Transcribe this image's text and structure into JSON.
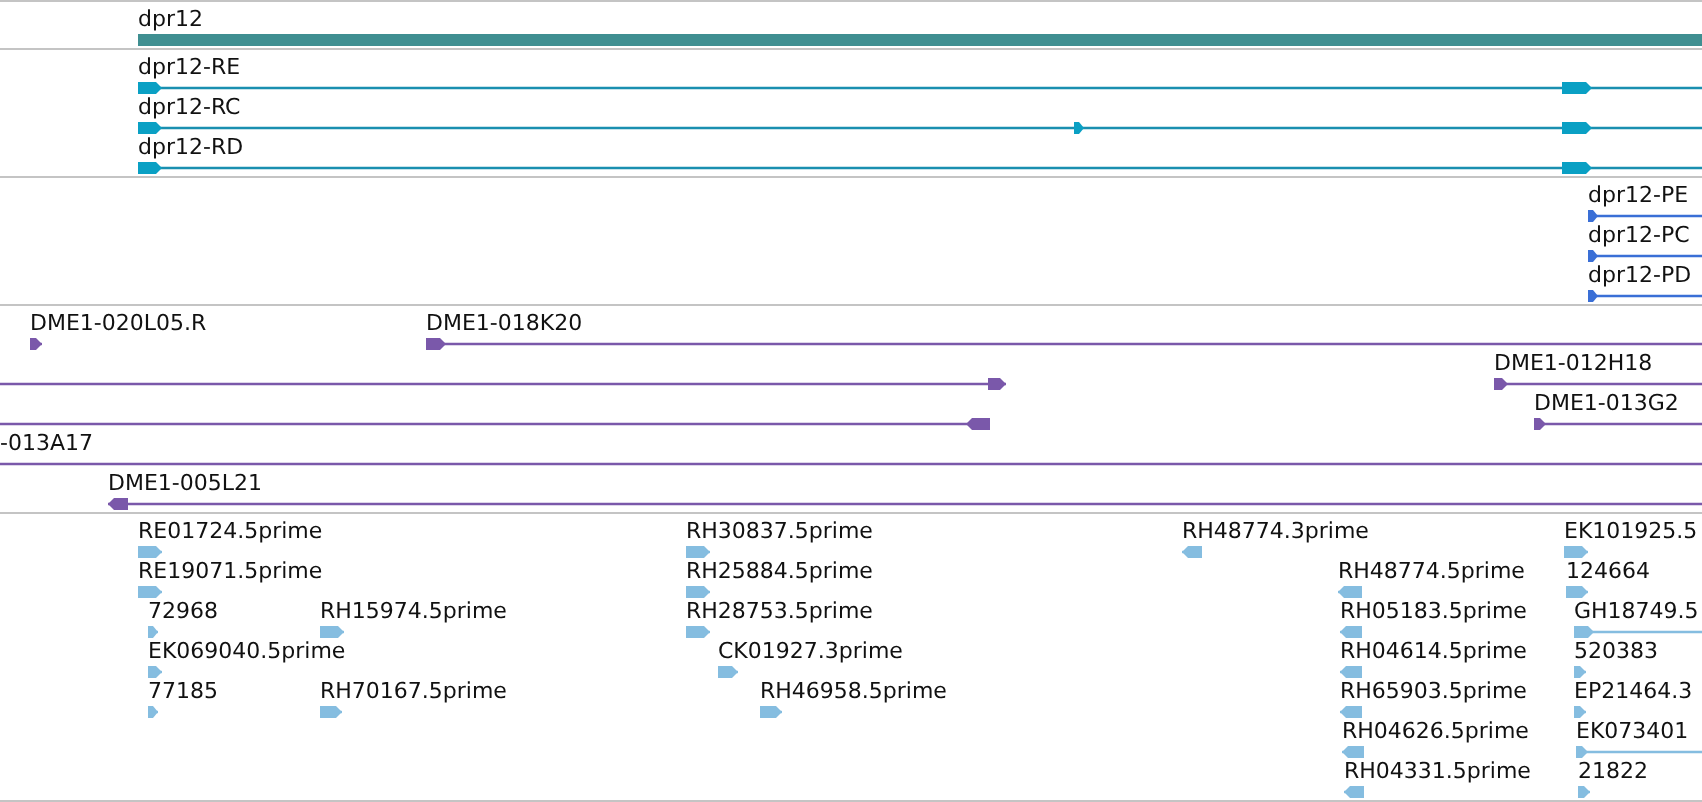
{
  "tracks": [
    {
      "kind": "gene",
      "features": [
        {
          "label": "dpr12"
        }
      ]
    },
    {
      "kind": "transcript",
      "features": [
        {
          "label": "dpr12-RE",
          "reverse": false
        },
        {
          "label": "dpr12-RC",
          "reverse": false
        },
        {
          "label": "dpr12-RD",
          "reverse": false
        }
      ]
    },
    {
      "kind": "protein",
      "features": [
        {
          "label": "dpr12-PE",
          "reverse": false
        },
        {
          "label": "dpr12-PC",
          "reverse": false
        },
        {
          "label": "dpr12-PD",
          "reverse": false
        }
      ]
    },
    {
      "kind": "clone",
      "features": [
        {
          "label": "DME1-020L05.R",
          "reverse": false
        },
        {
          "label": "DME1-018K20",
          "reverse": false
        },
        {
          "reverse": false
        },
        {
          "label": "DME1-012H18",
          "reverse": false
        },
        {
          "reverse": true
        },
        {
          "label": "DME1-013G2",
          "reverse": false
        },
        {
          "label": "-013A17"
        },
        {
          "label": "DME1-005L21",
          "reverse": true
        }
      ]
    },
    {
      "kind": "est",
      "features": [
        {
          "label": "RE01724.5prime",
          "reverse": false
        },
        {
          "label": "RE19071.5prime",
          "reverse": false
        },
        {
          "label": "72968",
          "reverse": false
        },
        {
          "label": "EK069040.5prime",
          "reverse": false
        },
        {
          "label": "77185",
          "reverse": false
        },
        {
          "label": "RH15974.5prime",
          "reverse": false
        },
        {
          "label": "RH70167.5prime",
          "reverse": false
        },
        {
          "label": "RH30837.5prime",
          "reverse": false
        },
        {
          "label": "RH25884.5prime",
          "reverse": false
        },
        {
          "label": "RH28753.5prime",
          "reverse": false
        },
        {
          "label": "CK01927.3prime",
          "reverse": false
        },
        {
          "label": "RH46958.5prime",
          "reverse": false
        },
        {
          "label": "RH48774.3prime",
          "reverse": true
        },
        {
          "label": "RH48774.5prime",
          "reverse": true
        },
        {
          "label": "RH05183.5prime",
          "reverse": true
        },
        {
          "label": "RH04614.5prime",
          "reverse": true
        },
        {
          "label": "RH65903.5prime",
          "reverse": true
        },
        {
          "label": "RH04626.5prime",
          "reverse": true
        },
        {
          "label": "RH04331.5prime",
          "reverse": true
        },
        {
          "label": "EK101925.5",
          "reverse": false
        },
        {
          "label": "124664",
          "reverse": false
        },
        {
          "label": "GH18749.5",
          "reverse": false
        },
        {
          "label": "520383",
          "reverse": false
        },
        {
          "label": "EP21464.3",
          "reverse": false
        },
        {
          "label": "EK073401",
          "reverse": false
        },
        {
          "label": "21822",
          "reverse": false
        }
      ]
    }
  ]
}
